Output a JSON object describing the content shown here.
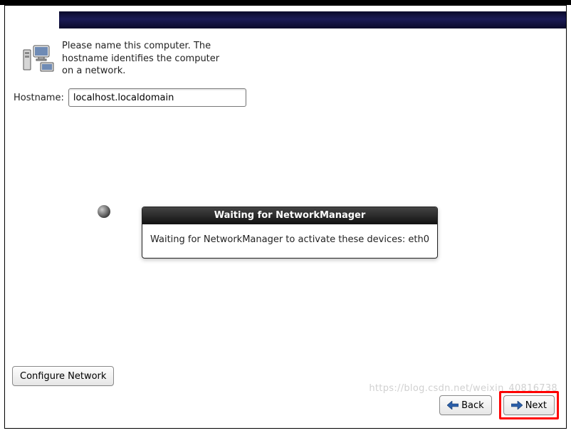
{
  "intro": {
    "text": "Please name this computer.  The hostname identifies the computer on a network."
  },
  "hostname": {
    "label": "Hostname:",
    "value": "localhost.localdomain"
  },
  "dialog": {
    "title": "Waiting for NetworkManager",
    "message": "Waiting for NetworkManager to activate these devices: eth0"
  },
  "buttons": {
    "configure": "Configure Network",
    "back": "Back",
    "next": "Next"
  },
  "watermark": "https://blog.csdn.net/weixin_40816738"
}
